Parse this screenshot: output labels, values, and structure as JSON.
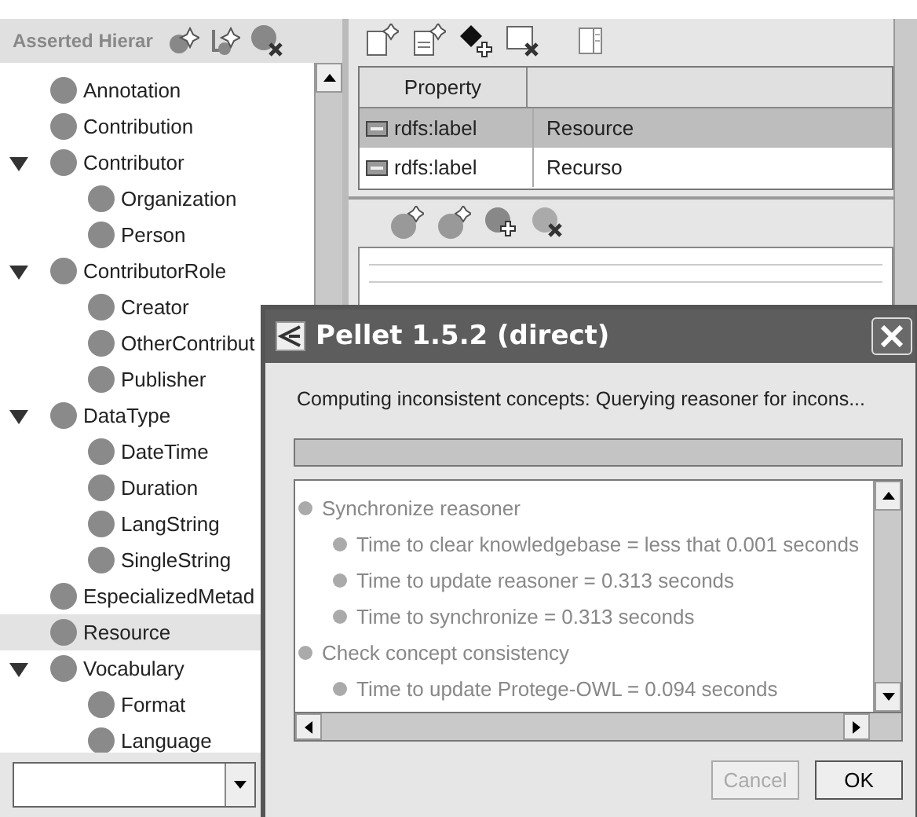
{
  "hierarchy": {
    "title": "Asserted Hierar",
    "items": [
      {
        "label": "Annotation",
        "selected": false
      },
      {
        "label": "Contribution",
        "selected": false
      },
      {
        "label": "Contributor",
        "selected": false,
        "expanded": true,
        "children": [
          {
            "label": "Organization",
            "selected": false
          },
          {
            "label": "Person",
            "selected": false
          }
        ]
      },
      {
        "label": "ContributorRole",
        "selected": false,
        "expanded": true,
        "children": [
          {
            "label": "Creator",
            "selected": false
          },
          {
            "label": "OtherContribut",
            "selected": false
          },
          {
            "label": "Publisher",
            "selected": false
          }
        ]
      },
      {
        "label": "DataType",
        "selected": false,
        "expanded": true,
        "children": [
          {
            "label": "DateTime",
            "selected": false
          },
          {
            "label": "Duration",
            "selected": false
          },
          {
            "label": "LangString",
            "selected": false
          },
          {
            "label": "SingleString",
            "selected": false
          }
        ]
      },
      {
        "label": "EspecializedMetad",
        "selected": false
      },
      {
        "label": "Resource",
        "selected": true
      },
      {
        "label": "Vocabulary",
        "selected": false,
        "expanded": true,
        "children": [
          {
            "label": "Format",
            "selected": false
          },
          {
            "label": "Language",
            "selected": false
          }
        ]
      }
    ]
  },
  "properties": {
    "columns": [
      "Property"
    ],
    "rows": [
      {
        "property": "rdfs:label",
        "value": "Resource",
        "selected": true
      },
      {
        "property": "rdfs:label",
        "value": "Recurso",
        "selected": false
      }
    ]
  },
  "dialog": {
    "title": "Pellet 1.5.2 (direct)",
    "message": "Computing inconsistent concepts: Querying reasoner for incons...",
    "log": [
      {
        "text": "Synchronize reasoner",
        "children": [
          {
            "text": "Time to clear knowledgebase = less that 0.001 seconds"
          },
          {
            "text": "Time to update reasoner = 0.313 seconds"
          },
          {
            "text": "Time to synchronize = 0.313 seconds"
          }
        ]
      },
      {
        "text": "Check concept consistency",
        "children": [
          {
            "text": "Time to update Protege-OWL = 0.094 seconds"
          }
        ]
      }
    ],
    "buttons": [
      {
        "label": "Cancel",
        "disabled": true
      },
      {
        "label": "OK",
        "disabled": false
      }
    ]
  }
}
